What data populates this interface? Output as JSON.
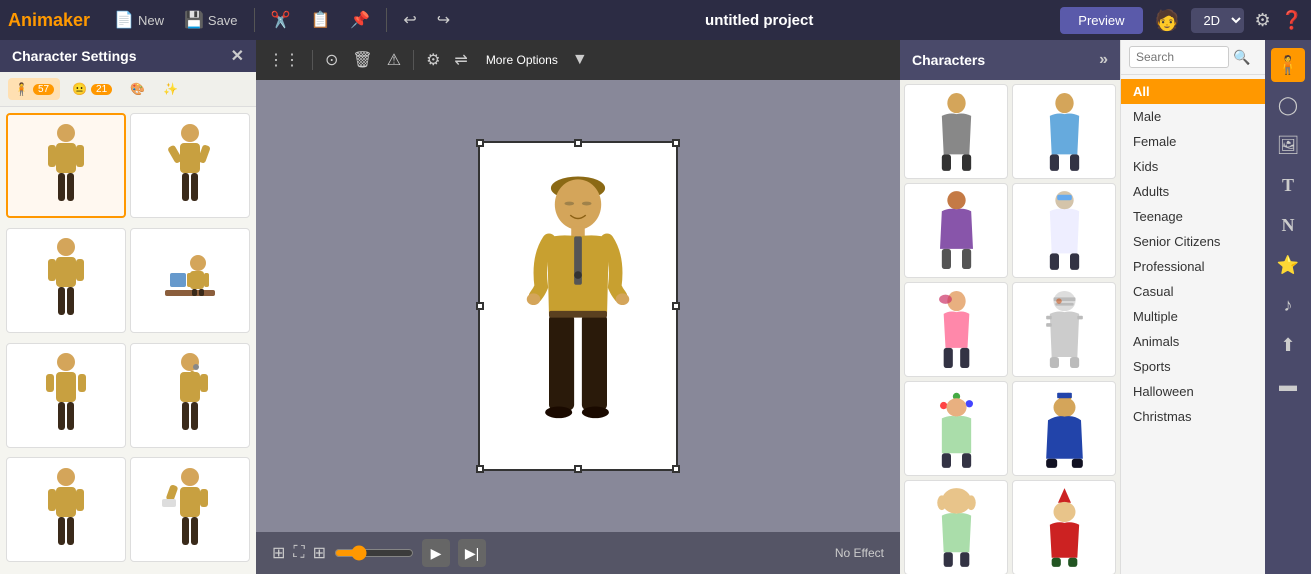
{
  "app": {
    "name": "Animaker"
  },
  "topbar": {
    "new_label": "New",
    "save_label": "Save",
    "project_title": "untitled project",
    "preview_label": "Preview",
    "dimension_label": "2D"
  },
  "left_panel": {
    "title": "Character Settings",
    "tab_poses_count": "57",
    "tab_expression_count": "21"
  },
  "context_toolbar": {
    "options_label": "More Options"
  },
  "bottom_bar": {
    "effect_label": "No Effect"
  },
  "chars_panel": {
    "title": "Characters"
  },
  "filter": {
    "search_placeholder": "Search",
    "items": [
      {
        "id": "all",
        "label": "All",
        "active": true
      },
      {
        "id": "male",
        "label": "Male",
        "active": false
      },
      {
        "id": "female",
        "label": "Female",
        "active": false
      },
      {
        "id": "kids",
        "label": "Kids",
        "active": false
      },
      {
        "id": "adults",
        "label": "Adults",
        "active": false
      },
      {
        "id": "teenage",
        "label": "Teenage",
        "active": false
      },
      {
        "id": "senior-citizens",
        "label": "Senior Citizens",
        "active": false
      },
      {
        "id": "professional",
        "label": "Professional",
        "active": false
      },
      {
        "id": "casual",
        "label": "Casual",
        "active": false
      },
      {
        "id": "multiple",
        "label": "Multiple",
        "active": false
      },
      {
        "id": "animals",
        "label": "Animals",
        "active": false
      },
      {
        "id": "sports",
        "label": "Sports",
        "active": false
      },
      {
        "id": "halloween",
        "label": "Halloween",
        "active": false
      },
      {
        "id": "christmas",
        "label": "Christmas",
        "active": false
      }
    ]
  }
}
